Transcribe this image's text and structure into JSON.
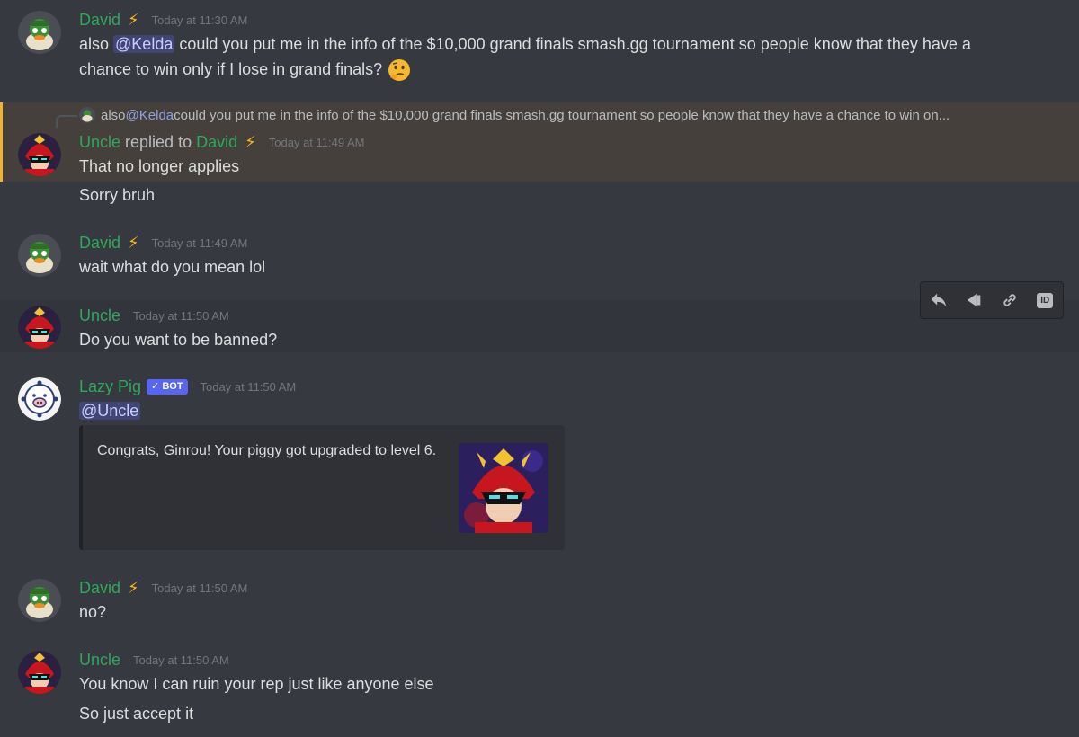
{
  "messages": {
    "m1": {
      "author": "David",
      "badge_emoji": "⚡",
      "timestamp": "Today at 11:30 AM",
      "line1_pre": "also ",
      "mention": "@Kelda",
      "line1_post": " could you put me in the info of the $10,000 grand finals smash.gg tournament so people know that they have a",
      "line2": "chance to win only if I lose in grand finals?",
      "emoji_name": "thinking-face-emoji"
    },
    "m2": {
      "reply_preview_pre": "also ",
      "reply_preview_mention": "@Kelda",
      "reply_preview_post": " could you put me in the info of the $10,000 grand finals smash.gg tournament so people know that they have a chance to win on...",
      "author": "Uncle",
      "replied_to_label": "replied to",
      "replied_to_user": "David",
      "replied_badge": "⚡",
      "timestamp": "Today at 11:49 AM",
      "text1": "That no longer applies",
      "text2": "Sorry bruh"
    },
    "m3": {
      "author": "David",
      "badge_emoji": "⚡",
      "timestamp": "Today at 11:49 AM",
      "text": "wait what do you mean lol"
    },
    "m4": {
      "author": "Uncle",
      "timestamp": "Today at 11:50 AM",
      "text": "Do you want to be banned?"
    },
    "m5": {
      "author": "Lazy Pig",
      "bot_tag": "✓ BOT",
      "timestamp": "Today at 11:50 AM",
      "mention": "@Uncle",
      "embed_text": "Congrats, Ginrou! Your piggy got upgraded to level 6."
    },
    "m6": {
      "author": "David",
      "badge_emoji": "⚡",
      "timestamp": "Today at 11:50 AM",
      "text": "no?"
    },
    "m7": {
      "author": "Uncle",
      "timestamp": "Today at 11:50 AM",
      "text1": "You know I can ruin your rep just like anyone else",
      "text2": "So just accept it"
    }
  },
  "toolbar": {
    "icons": [
      "reply-icon",
      "pin-icon",
      "link-icon",
      "copy-id-icon"
    ],
    "id_label": "ID"
  },
  "colors": {
    "background": "#36393f",
    "author_green": "#2fa75c",
    "highlight": "#45403b",
    "highlight_bar": "#f0b232",
    "blurple": "#5865f2"
  }
}
